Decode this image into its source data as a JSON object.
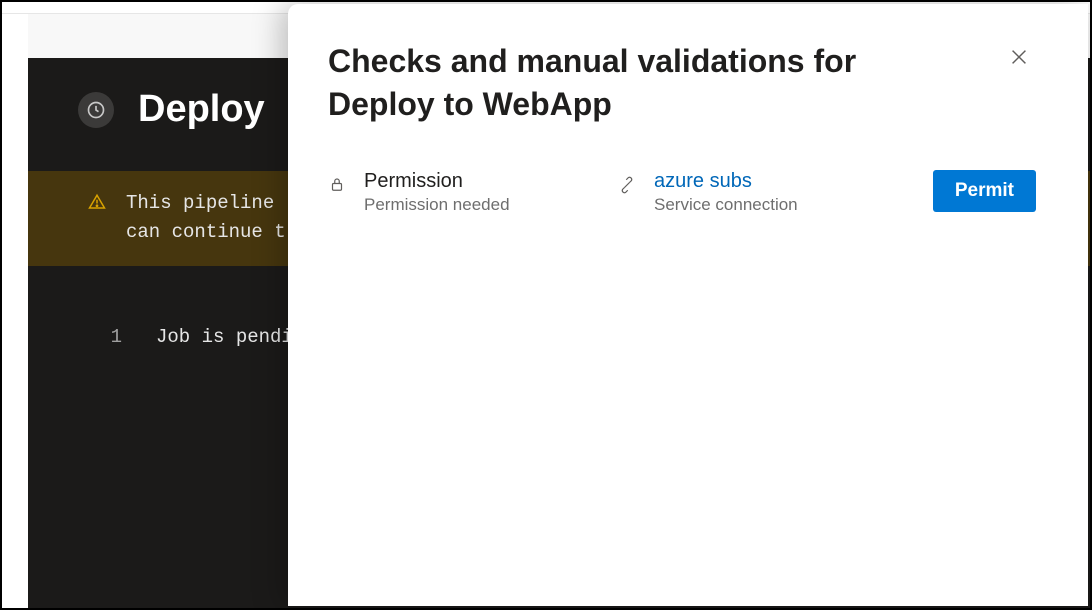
{
  "background": {
    "title": "Deploy",
    "banner_line1": "This pipeline",
    "banner_line2": "can continue t",
    "log_line_num": "1",
    "log_line_text": "Job is pending"
  },
  "panel": {
    "title": "Checks and manual validations for Deploy to WebApp",
    "permission": {
      "label": "Permission",
      "sub": "Permission needed"
    },
    "resource": {
      "label": "azure subs",
      "sub": "Service connection"
    },
    "permit_button": "Permit"
  }
}
